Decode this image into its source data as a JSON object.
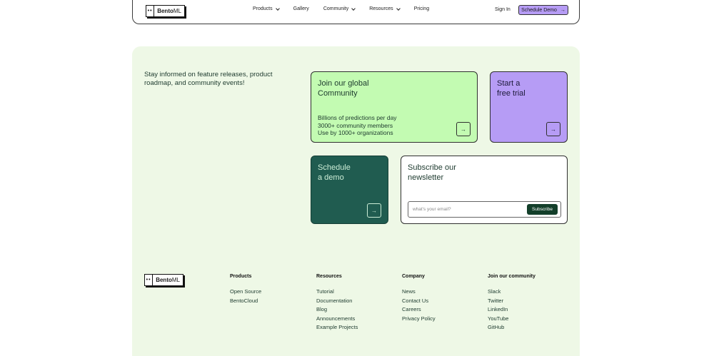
{
  "nav": {
    "logo_text": "Bento",
    "logo_text_light": "ML",
    "logo_mark": "••",
    "links": [
      {
        "label": "Products",
        "dropdown": true
      },
      {
        "label": "Gallery",
        "dropdown": false
      },
      {
        "label": "Community",
        "dropdown": true
      },
      {
        "label": "Resources",
        "dropdown": true
      },
      {
        "label": "Pricing",
        "dropdown": false
      }
    ],
    "signin": "Sign In",
    "demo_button": "Schedule Demo"
  },
  "intro": "Stay informed on feature releases, product roadmap, and community events!",
  "cards": {
    "community": {
      "title_line1": "Join our global",
      "title_line2": "Community",
      "stat1": "Billions of predictions per day",
      "stat2": "3000+ community members",
      "stat3": "Use by 1000+ organizations"
    },
    "trial": {
      "title_line1": "Start a",
      "title_line2": "free trial"
    },
    "demo": {
      "title_line1": "Schedule",
      "title_line2": "a demo"
    },
    "newsletter": {
      "title_line1": "Subscribe our",
      "title_line2": "newsletter",
      "email_placeholder": "what's your email?",
      "subscribe": "Subscribe"
    }
  },
  "footer": {
    "columns": [
      {
        "title": "Products",
        "items": [
          "Open Source",
          "BentoCloud"
        ]
      },
      {
        "title": "Resources",
        "items": [
          "Tutorial",
          "Documentation",
          "Blog",
          "Announcements",
          "Example Projects"
        ]
      },
      {
        "title": "Company",
        "items": [
          "News",
          "Contact Us",
          "Careers",
          "Privacy Policy"
        ]
      },
      {
        "title": "Join our community",
        "items": [
          "Slack",
          "Twitter",
          "LinkedIn",
          "YouTube",
          "GitHub"
        ]
      }
    ]
  },
  "icons": {
    "arrow": "arrow-right-icon",
    "chevron": "chevron-down-icon"
  },
  "colors": {
    "accent_green": "#c3fbb2",
    "accent_purple": "#b69cf5",
    "dark_green": "#205c50",
    "section_bg": "#eef8e6"
  }
}
